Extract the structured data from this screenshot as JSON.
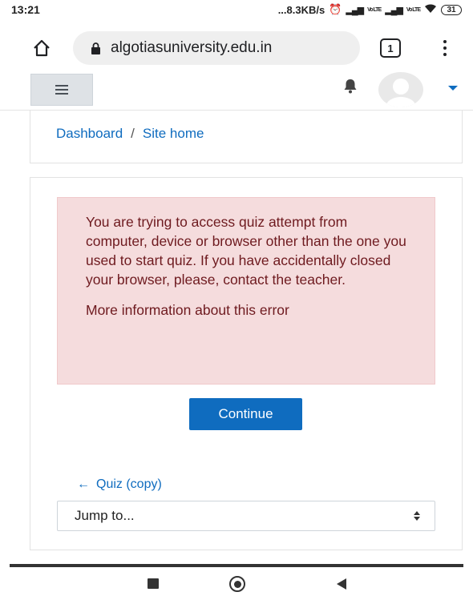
{
  "status_bar": {
    "time": "13:21",
    "network_speed": "...8.3KB/s",
    "alarm_icon": "alarm-clock-icon",
    "signal1": "Vo LTE",
    "signal2": "Vo LTE",
    "battery": "31"
  },
  "browser": {
    "url": "algotiasuniversity.edu.in",
    "tab_count": "1",
    "icons": [
      "home-icon",
      "lock-icon",
      "tabs-icon",
      "overflow-menu-icon"
    ]
  },
  "navbar": {
    "icons": [
      "hamburger-icon",
      "bell-icon",
      "avatar",
      "caret-down-icon"
    ],
    "accent": "#0f6cbf"
  },
  "breadcrumb": {
    "items": [
      "Dashboard",
      "Site home"
    ],
    "separator": "/"
  },
  "error": {
    "message": "You are trying to access quiz attempt from computer, device or browser other than the one you used to start quiz. If you have accidentally closed your browser, please, contact the teacher.",
    "more_info": "More information about this error",
    "background": "#f5dcdd",
    "text_color": "#6e1a1f"
  },
  "actions": {
    "continue_label": "Continue"
  },
  "navigation": {
    "prev_arrow": "←",
    "prev_label": "Quiz (copy)",
    "jump_placeholder": "Jump to..."
  }
}
